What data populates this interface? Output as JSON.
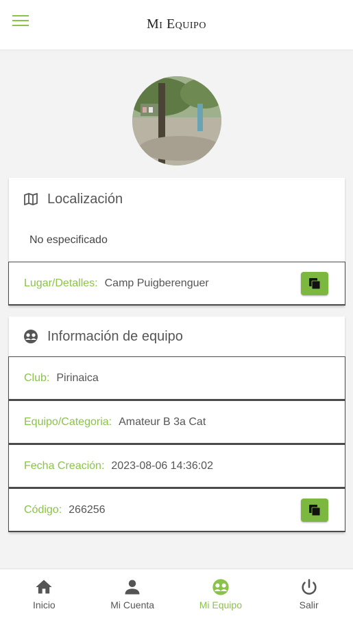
{
  "header": {
    "title": "Mi Equipo"
  },
  "profile": {
    "avatar": "team-photo"
  },
  "location_card": {
    "title": "Localización",
    "description": "No especificado",
    "rows": [
      {
        "label": "Lugar/Detalles:",
        "value": "Camp Puigberenguer"
      }
    ]
  },
  "team_card": {
    "title": "Información de equipo",
    "rows": [
      {
        "label": "Club:",
        "value": "Pirinaica"
      },
      {
        "label": "Equipo/Categoria:",
        "value": "Amateur B 3a Cat"
      },
      {
        "label": "Fecha Creación:",
        "value": "2023-08-06 14:36:02"
      },
      {
        "label": "Código:",
        "value": "266256"
      }
    ]
  },
  "nav": {
    "items": [
      {
        "label": "Inicio",
        "icon": "home-icon"
      },
      {
        "label": "Mi Cuenta",
        "icon": "person-icon"
      },
      {
        "label": "Mi Equipo",
        "icon": "team-icon"
      },
      {
        "label": "Salir",
        "icon": "power-icon"
      }
    ],
    "active": "Mi Equipo"
  },
  "colors": {
    "accent": "#8bc34a",
    "button": "#7cb83f"
  }
}
